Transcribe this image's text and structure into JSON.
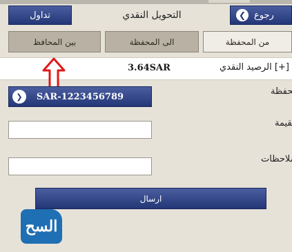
{
  "header": {
    "title": "التحويل النقدي",
    "back_label": "رجوع",
    "trade_label": "تداول"
  },
  "tabs": [
    {
      "label": "من المحفظة",
      "selected": true
    },
    {
      "label": "الى المحفظة",
      "selected": false
    },
    {
      "label": "بين المحافظ",
      "selected": false
    }
  ],
  "balance": {
    "label": "الرصيد النقدي [+]",
    "value": "3.64SAR"
  },
  "form": {
    "wallet_label": "المحفظة",
    "wallet_value": "SAR-1223456789",
    "value_label": "القيمة",
    "value_input": "",
    "notes_label": "الملاحظات",
    "notes_input": "",
    "send_label": "ارسال"
  },
  "logo": {
    "text": "السح"
  },
  "colors": {
    "button_blue": "#243777",
    "background": "#e6e2d8",
    "arrow_red": "#e01818"
  }
}
